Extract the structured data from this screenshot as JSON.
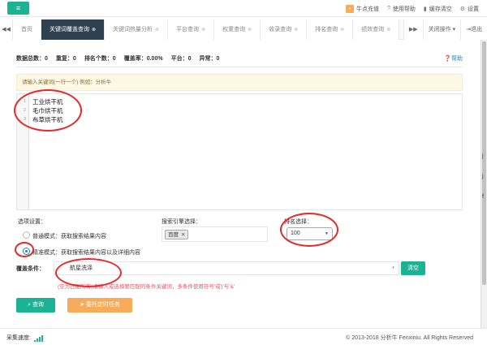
{
  "topbar": {
    "menu_icon": "hamburger-icon",
    "links": [
      {
        "icon": "bookmark-icon",
        "label": "牛点充值"
      },
      {
        "icon": "question-icon",
        "label": "使用帮助"
      },
      {
        "icon": "trash-icon",
        "label": "缓存清空"
      },
      {
        "icon": "gear-icon",
        "label": "设置"
      }
    ]
  },
  "tabs": {
    "items": [
      {
        "label": "首页",
        "active": false
      },
      {
        "label": "关键词覆盖查询",
        "active": true
      },
      {
        "label": "关键词热量分析",
        "active": false
      },
      {
        "label": "平台查询",
        "active": false
      },
      {
        "label": "权重查询",
        "active": false
      },
      {
        "label": "收录查询",
        "active": false
      },
      {
        "label": "排名查询",
        "active": false
      },
      {
        "label": "绩效查询",
        "active": false
      }
    ],
    "close_menu": "关闭操作",
    "logout": "退出"
  },
  "stats": {
    "total": "数据总数：0",
    "repeat": "重复：0",
    "ranked": "排名个数：0",
    "coverage": "覆盖率：0.00%",
    "platform": "平台：0",
    "abnormal": "异常：0",
    "help": "帮助"
  },
  "hint": "请输入关键词(一行一个)  例如：分析牛",
  "editor": {
    "line_numbers": [
      "1",
      "2",
      "3"
    ],
    "lines": [
      "工业烘干机",
      "毛巾烘干机",
      "布草烘干机"
    ]
  },
  "options": {
    "title": "选项设置：",
    "normal_mode": "普通模式：获取搜索结果内容",
    "precise_mode": "精准模式：获取搜索结果内容以及详细内容"
  },
  "engine": {
    "title": "搜索引擎选择：",
    "selected": "百度"
  },
  "rank": {
    "title": "排名选择：",
    "selected": "100"
  },
  "cover": {
    "label": "覆盖条件：",
    "value": "航星洗涤",
    "clear": "清空",
    "note": "(空为匹配所有)请输入或选择要匹配的条件关键词，多条件使用符号'或'|'与'&'"
  },
  "buttons": {
    "query": "查询",
    "task": "委托定时任务"
  },
  "footer": {
    "speed": "采集速度:",
    "copyright": "© 2013-2018 分析牛 Fenxiniu. All Rights Reserved"
  },
  "side_chars": [
    "j",
    "j",
    "f"
  ],
  "colors": {
    "primary": "#1ab394",
    "warning": "#f8ac59",
    "dark_tab": "#2f4050",
    "annotation": "#e8282a",
    "link": "#1c84c6"
  }
}
